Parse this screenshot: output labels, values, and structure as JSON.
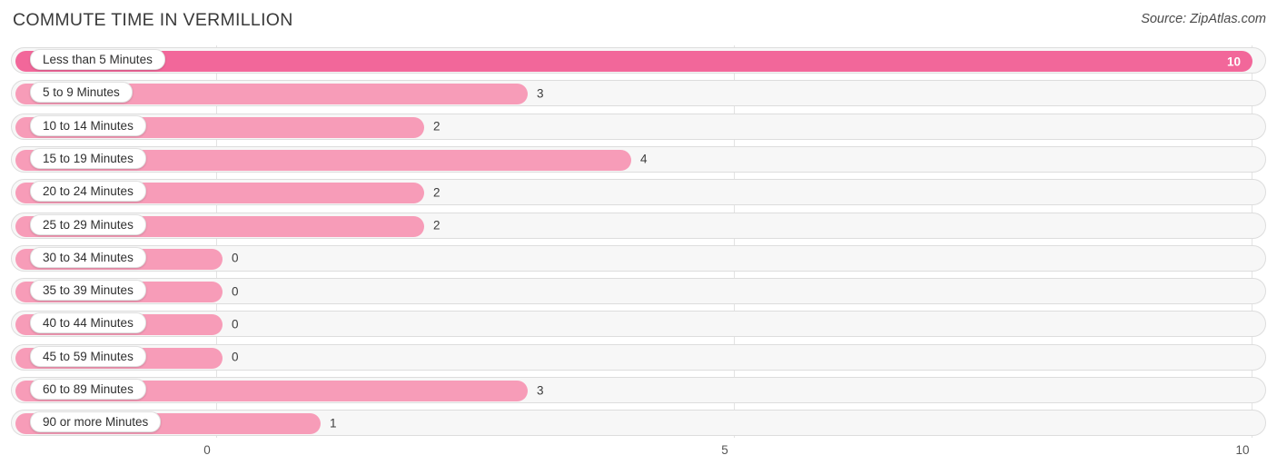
{
  "header": {
    "title": "COMMUTE TIME IN VERMILLION",
    "source": "Source: ZipAtlas.com"
  },
  "colors": {
    "bar_strong": "#f2679a",
    "bar_light": "#f79cb8",
    "track": "#f7f7f7",
    "track_border": "#dddddd",
    "gridline": "#e3e3e3",
    "text": "#3c3c3c"
  },
  "chart_data": {
    "type": "bar",
    "orientation": "horizontal",
    "title": "COMMUTE TIME IN VERMILLION",
    "xlabel": "",
    "ylabel": "",
    "xlim": [
      0,
      10
    ],
    "grid": true,
    "legend": "none",
    "xticks": [
      "0",
      "5",
      "10"
    ],
    "xtick_values": [
      0,
      5,
      10
    ],
    "categories": [
      "Less than 5 Minutes",
      "5 to 9 Minutes",
      "10 to 14 Minutes",
      "15 to 19 Minutes",
      "20 to 24 Minutes",
      "25 to 29 Minutes",
      "30 to 34 Minutes",
      "35 to 39 Minutes",
      "40 to 44 Minutes",
      "45 to 59 Minutes",
      "60 to 89 Minutes",
      "90 or more Minutes"
    ],
    "values": [
      10,
      3,
      2,
      4,
      2,
      2,
      0,
      0,
      0,
      0,
      3,
      1
    ],
    "value_labels": [
      "10",
      "3",
      "2",
      "4",
      "2",
      "2",
      "0",
      "0",
      "0",
      "0",
      "3",
      "1"
    ]
  }
}
